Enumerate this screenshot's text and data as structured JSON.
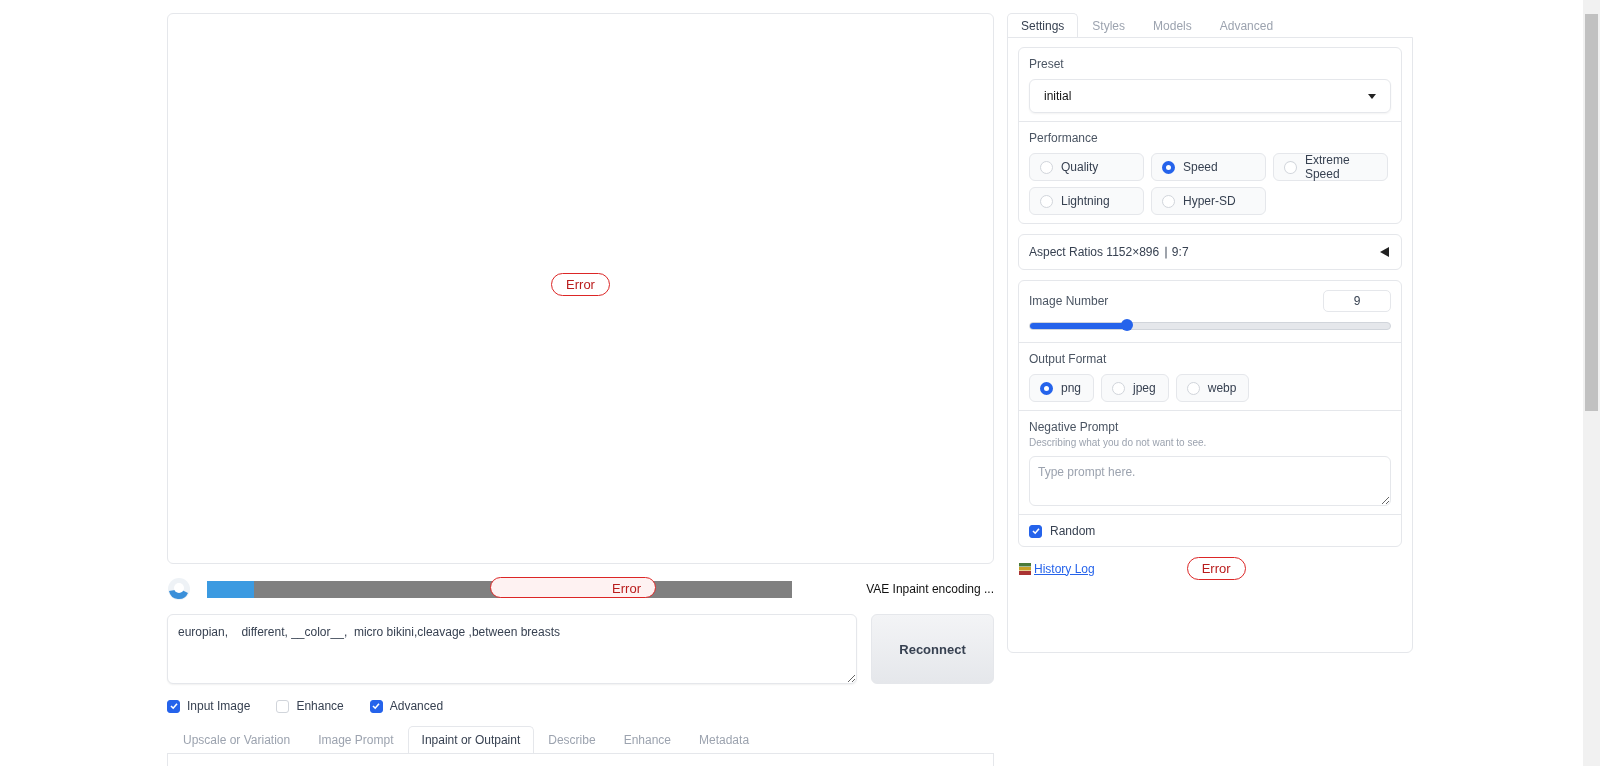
{
  "image_panel": {
    "error": "Error"
  },
  "progress": {
    "level": 0.08,
    "error": "Error",
    "status": "VAE Inpaint encoding ..."
  },
  "prompt": {
    "value": "europian,    different, __color__,  micro bikini,cleavage ,between breasts"
  },
  "reconnect_button": "Reconnect",
  "options": [
    {
      "label": "Input Image",
      "checked": true
    },
    {
      "label": "Enhance",
      "checked": false
    },
    {
      "label": "Advanced",
      "checked": true
    }
  ],
  "bottom_tabs": [
    {
      "label": "Upscale or Variation",
      "selected": false
    },
    {
      "label": "Image Prompt",
      "selected": false
    },
    {
      "label": "Inpaint or Outpaint",
      "selected": true
    },
    {
      "label": "Describe",
      "selected": false
    },
    {
      "label": "Enhance",
      "selected": false
    },
    {
      "label": "Metadata",
      "selected": false
    }
  ],
  "settings": {
    "tabs": [
      {
        "label": "Settings",
        "selected": true
      },
      {
        "label": "Styles",
        "selected": false
      },
      {
        "label": "Models",
        "selected": false
      },
      {
        "label": "Advanced",
        "selected": false
      }
    ],
    "preset": {
      "label": "Preset",
      "value": "initial"
    },
    "performance": {
      "label": "Performance",
      "options": [
        {
          "label": "Quality",
          "selected": false
        },
        {
          "label": "Speed",
          "selected": true
        },
        {
          "label": "Extreme Speed",
          "selected": false
        },
        {
          "label": "Lightning",
          "selected": false
        },
        {
          "label": "Hyper-SD",
          "selected": false
        }
      ]
    },
    "aspect_ratios": {
      "label": "Aspect Ratios 1152×896 ∣ 9:7",
      "expanded": false
    },
    "image_number": {
      "label": "Image Number",
      "value": "9",
      "level": 0.27
    },
    "output_format": {
      "label": "Output Format",
      "options": [
        {
          "label": "png",
          "selected": true
        },
        {
          "label": "jpeg",
          "selected": false
        },
        {
          "label": "webp",
          "selected": false
        }
      ]
    },
    "negative_prompt": {
      "label": "Negative Prompt",
      "hint": "Describing what you do not want to see.",
      "placeholder": "Type prompt here."
    },
    "random": {
      "label": "Random",
      "checked": true
    }
  },
  "history_log": "History Log",
  "side_error": "Error"
}
